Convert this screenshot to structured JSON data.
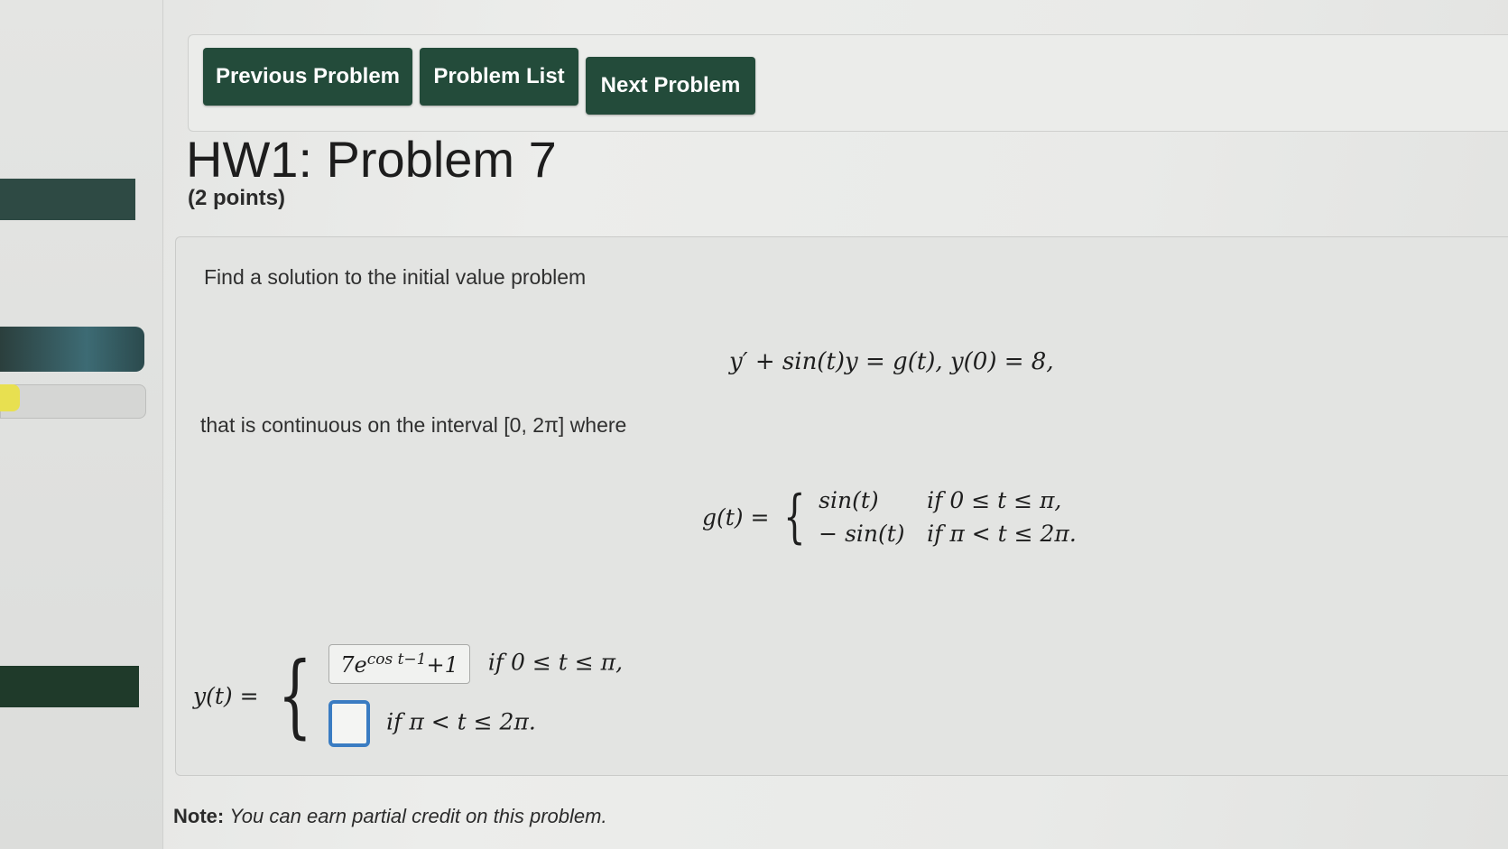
{
  "nav": {
    "previous": "Previous Problem",
    "list": "Problem List",
    "next": "Next Problem"
  },
  "problem": {
    "title": "HW1: Problem 7",
    "points": "(2 points)",
    "intro": "Find a solution to the initial value problem",
    "equation": "y′ + sin(t)y = g(t),   y(0) = 8,",
    "continuity_text": "that is continuous on the interval [0, 2π] where",
    "g_label": "g(t) =",
    "g_case1_expr": "sin(t)",
    "g_case1_cond": "if 0 ≤ t ≤ π,",
    "g_case2_expr": "− sin(t)",
    "g_case2_cond": "if π < t ≤ 2π.",
    "y_label": "y(t) =",
    "y_case1_answer_base": "7e",
    "y_case1_answer_exp": "cos t−1",
    "y_case1_answer_tail": "+1",
    "y_case1_cond": "if 0 ≤ t ≤ π,",
    "y_case2_answer": "",
    "y_case2_cond": "if π < t ≤ 2π."
  },
  "note": {
    "label": "Note:",
    "text": "You can earn partial credit on this problem."
  }
}
